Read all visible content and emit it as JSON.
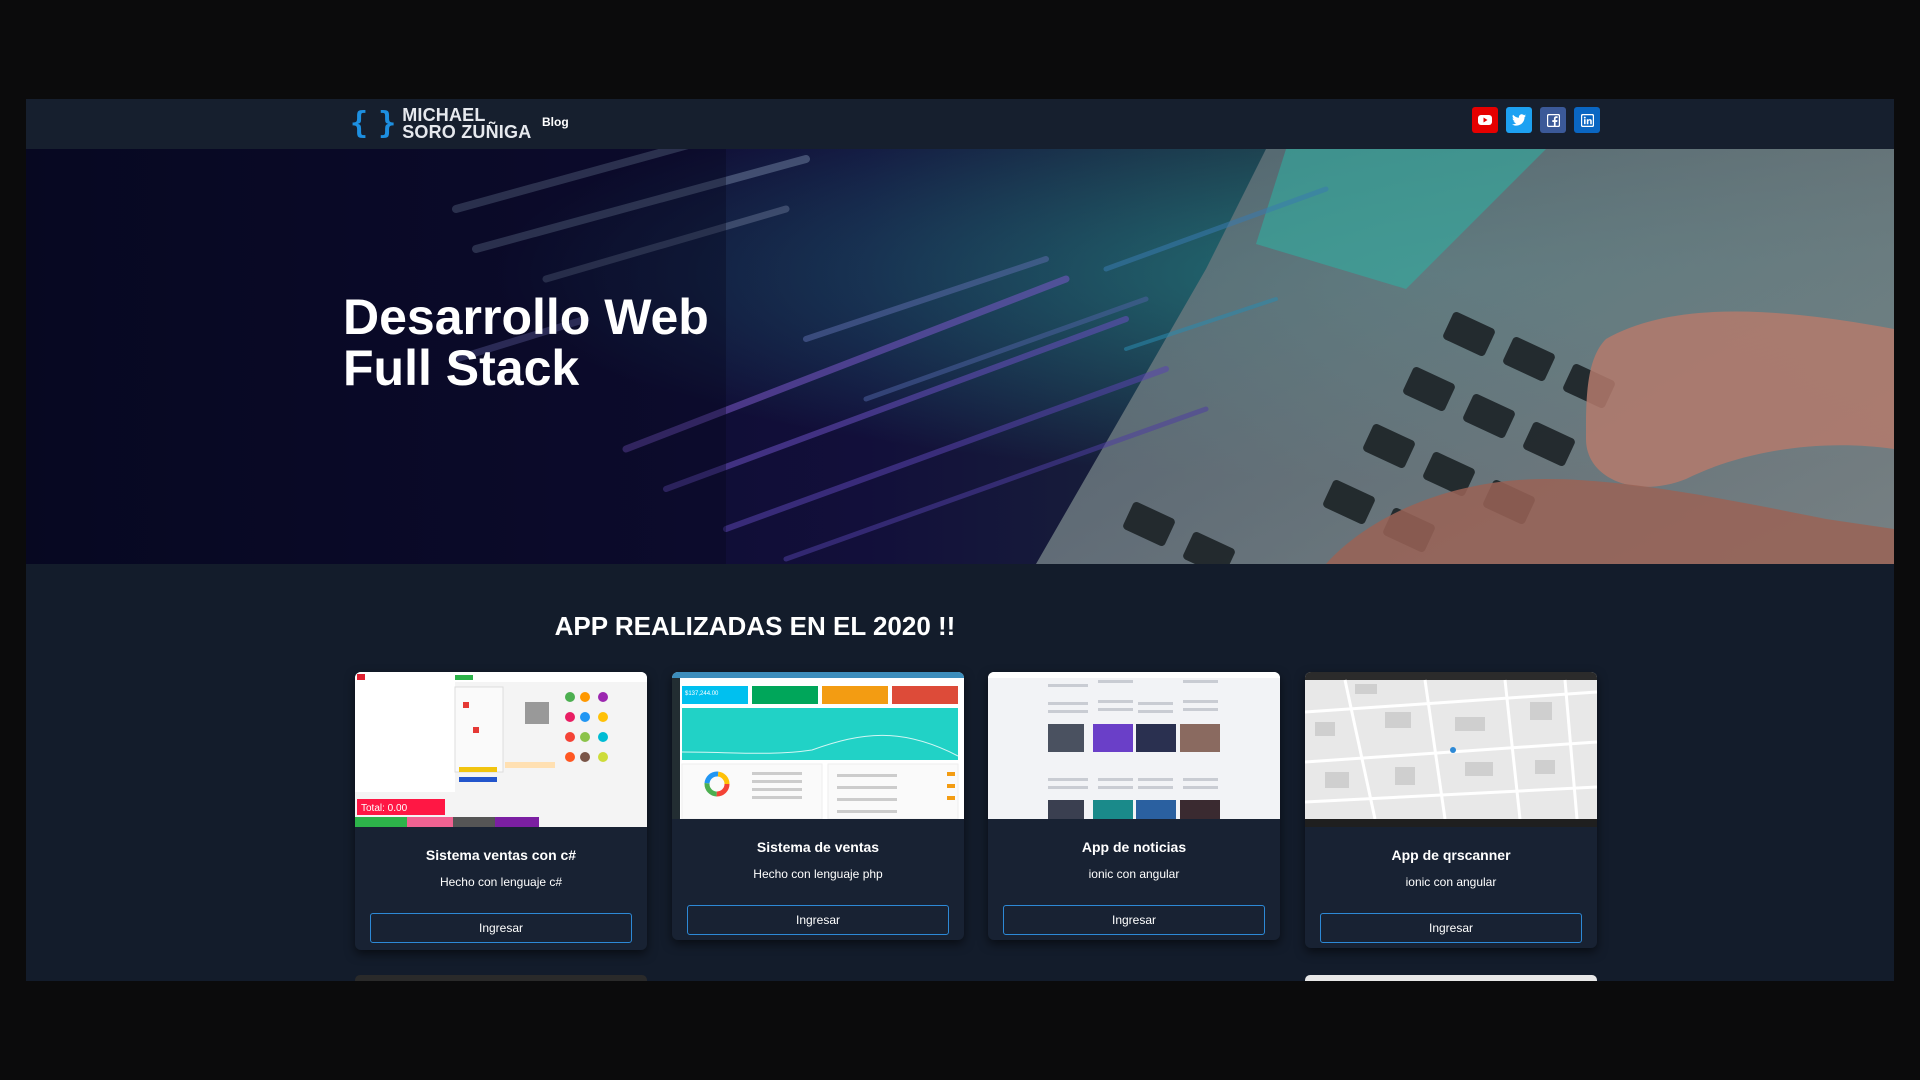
{
  "brand": {
    "brace": "{ }",
    "line1": "MICHAEL",
    "line2": "SORO ZUÑIGA"
  },
  "nav": {
    "blog": "Blog"
  },
  "social": [
    {
      "icon": "youtube-icon",
      "color": "#e60000"
    },
    {
      "icon": "twitter-icon",
      "color": "#1da1f2"
    },
    {
      "icon": "facebook-icon",
      "color": "#3b5998"
    },
    {
      "icon": "linkedin-icon",
      "color": "#0a66c2"
    }
  ],
  "hero": {
    "line1": "Desarrollo Web",
    "line2": "Full Stack"
  },
  "section": {
    "title": "APP REALIZADAS EN EL 2020 !!"
  },
  "cards": [
    {
      "title": "Sistema ventas con c#",
      "desc": "Hecho con lenguaje c#",
      "button": "Ingresar",
      "total": "Total: 0.00"
    },
    {
      "title": "Sistema de ventas",
      "desc": "Hecho con lenguaje php",
      "button": "Ingresar",
      "stat": "$137,244.00"
    },
    {
      "title": "App de noticias",
      "desc": "ionic con angular",
      "button": "Ingresar"
    },
    {
      "title": "App de qrscanner",
      "desc": "ionic con angular",
      "button": "Ingresar"
    }
  ],
  "colors": {
    "accent": "#2d89d6",
    "background": "#131c2b",
    "card": "#182233"
  }
}
